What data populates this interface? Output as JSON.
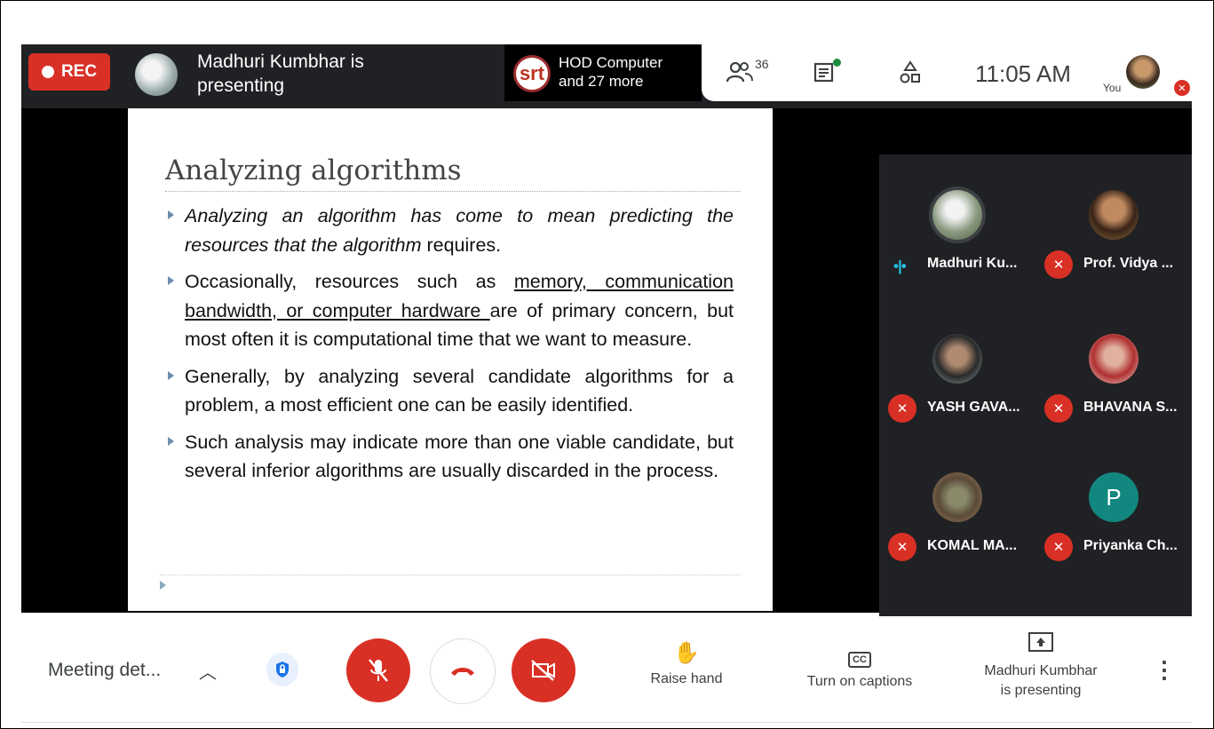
{
  "topbar": {
    "rec_label": "REC",
    "presenter_line1": "Madhuri Kumbhar is",
    "presenter_line2": "presenting",
    "share_logo": "srt",
    "share_line1": "HOD Computer",
    "share_line2": "and 27 more",
    "participant_count": "36",
    "time": "11:05 AM",
    "you_label": "You",
    "icons": [
      "people-icon",
      "chat-icon",
      "activities-icon"
    ]
  },
  "slide": {
    "title": "Analyzing algorithms",
    "bullets": [
      {
        "italic_part": "Analyzing an algorithm has come to mean predicting the resources that the algorithm",
        "rest": " requires."
      },
      {
        "pre": "Occasionally, resources such as ",
        "underlined": "memory, communication bandwidth, or computer hardware ",
        "post": "are of primary concern, but most often it is computational time that we want to measure."
      },
      {
        "text": "Generally, by analyzing several candidate algorithms for a problem, a most efficient one can be easily identified."
      },
      {
        "text": "Such analysis may indicate more than one viable candidate, but several inferior algorithms are usually discarded in the process."
      }
    ]
  },
  "participants": [
    {
      "name": "Madhuri Ku...",
      "muted": false,
      "color": "#7a8a6a"
    },
    {
      "name": "Prof. Vidya ...",
      "muted": true,
      "color": "#6a4a3a"
    },
    {
      "name": "YASH GAVA...",
      "muted": true,
      "color": "#5a6a6a"
    },
    {
      "name": "BHAVANA S...",
      "muted": true,
      "color": "#a05050"
    },
    {
      "name": "KOMAL MA...",
      "muted": true,
      "color": "#6a6a50"
    },
    {
      "name": "Priyanka Ch...",
      "muted": true,
      "color": "#12877f",
      "initial": "P"
    }
  ],
  "bottombar": {
    "meeting_details": "Meeting det...",
    "raise_hand": "Raise hand",
    "captions": "Turn on captions",
    "presenting_line1": "Madhuri Kumbhar",
    "presenting_line2": "is presenting",
    "cc_icon": "CC"
  }
}
